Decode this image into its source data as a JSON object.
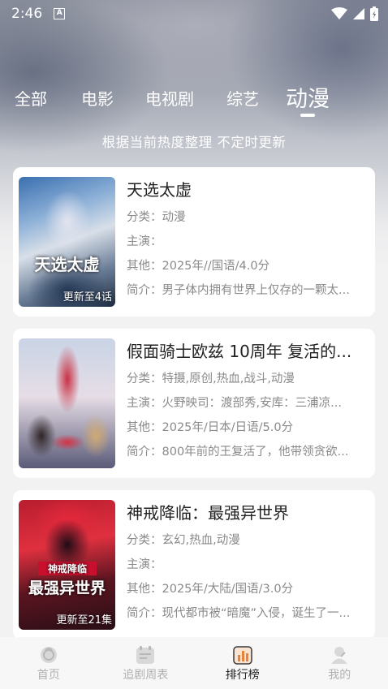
{
  "status_bar": {
    "time": "2:46",
    "notification_icon": "A"
  },
  "tabs": [
    {
      "label": "全部"
    },
    {
      "label": "电影"
    },
    {
      "label": "电视剧"
    },
    {
      "label": "综艺"
    },
    {
      "label": "动漫",
      "active": true
    }
  ],
  "subtitle": "根据当前热度整理 不定时更新",
  "items": [
    {
      "title": "天选太虚",
      "category": "分类：动漫",
      "cast": "主演：",
      "other": "其他：2025年//国语/4.0分",
      "intro": "简介：男子体内拥有世界上仅存的一颗太...",
      "badge": "更新至4话",
      "poster_text": "天选太虚"
    },
    {
      "title": "假面骑士欧兹 10周年 复活的...",
      "category": "分类：特摄,原创,热血,战斗,动漫",
      "cast": "主演：火野映司：渡部秀,安库：三浦凉...",
      "other": "其他：2025年/日本/日语/5.0分",
      "intro": "简介：800年前的王复活了，他带领贪欲...",
      "badge": "",
      "poster_text": ""
    },
    {
      "title": "神戒降临：最强异世界",
      "category": "分类：玄幻,热血,动漫",
      "cast": "主演：",
      "other": "其他：2025年/大陆/国语/3.0分",
      "intro": "简介：现代都市被“暗魔”入侵，诞生了一...",
      "badge": "更新至21集",
      "poster_text": "最强异世界",
      "poster_subtext": "神戒降临"
    }
  ],
  "bottom_nav": [
    {
      "label": "首页",
      "icon": "home-icon"
    },
    {
      "label": "追剧周表",
      "icon": "calendar-icon"
    },
    {
      "label": "排行榜",
      "icon": "chart-icon",
      "active": true
    },
    {
      "label": "我的",
      "icon": "profile-icon"
    }
  ],
  "colors": {
    "accent": "#ffffff",
    "active_nav": "#222222",
    "inactive_nav": "#b0b0b0",
    "chart_icon": "#e8833a"
  }
}
